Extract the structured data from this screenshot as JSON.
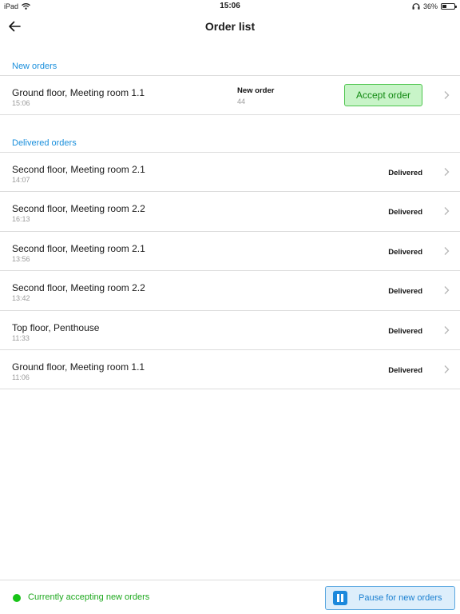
{
  "status_bar": {
    "device": "iPad",
    "time": "15:06",
    "battery": "36%",
    "battery_level": 0.36,
    "icons": [
      "wifi-icon",
      "headphones-icon",
      "battery-icon"
    ]
  },
  "nav": {
    "title": "Order list",
    "back_icon": "arrow-left-icon"
  },
  "new_orders": {
    "header": "New orders",
    "items": [
      {
        "title": "Ground floor, Meeting room 1.1",
        "time": "15:06",
        "status": "New order",
        "number": "44",
        "action": "Accept order"
      }
    ]
  },
  "delivered_orders": {
    "header": "Delivered orders",
    "items": [
      {
        "title": "Second floor, Meeting room 2.1",
        "time": "14:07",
        "status": "Delivered"
      },
      {
        "title": "Second floor, Meeting room 2.2",
        "time": "16:13",
        "status": "Delivered"
      },
      {
        "title": "Second floor, Meeting room 2.1",
        "time": "13:56",
        "status": "Delivered"
      },
      {
        "title": "Second floor, Meeting room 2.2",
        "time": "13:42",
        "status": "Delivered"
      },
      {
        "title": "Top floor, Penthouse",
        "time": "11:33",
        "status": "Delivered"
      },
      {
        "title": "Ground floor, Meeting room 1.1",
        "time": "11:06",
        "status": "Delivered"
      }
    ]
  },
  "footer": {
    "status_text": "Currently accepting new orders",
    "pause_label": "Pause for new orders"
  },
  "colors": {
    "accent": "#1a8fdc",
    "success": "#18c418",
    "accept_bg": "#c8f4c8"
  }
}
